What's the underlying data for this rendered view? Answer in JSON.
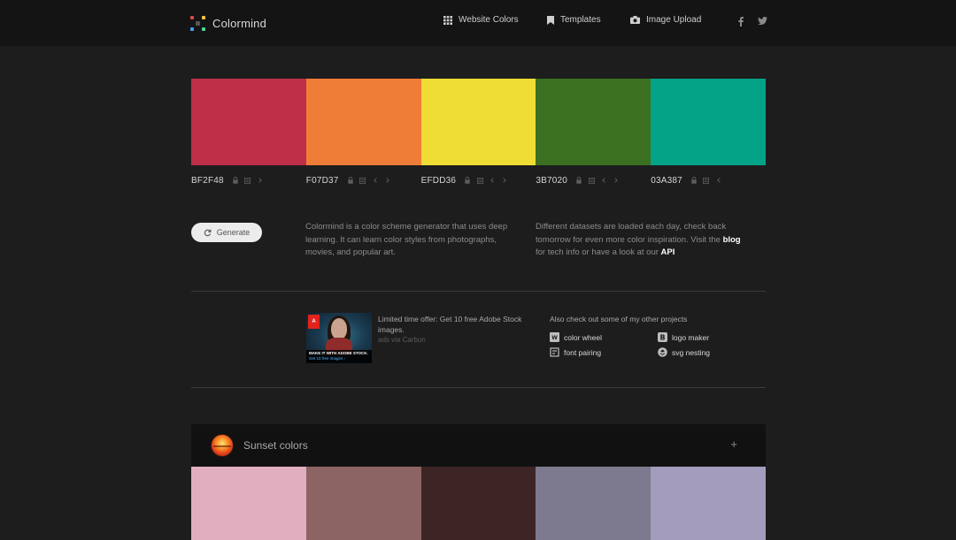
{
  "header": {
    "brand": "Colormind",
    "logo_colors": [
      "#e0474c",
      "#f3c340",
      "#43a3f0",
      "#4dd39a"
    ],
    "nav": [
      {
        "label": "Website Colors",
        "icon": "grid-icon"
      },
      {
        "label": "Templates",
        "icon": "bookmark-icon"
      },
      {
        "label": "Image Upload",
        "icon": "camera-icon"
      }
    ],
    "social": [
      {
        "icon": "facebook-icon"
      },
      {
        "icon": "twitter-icon"
      }
    ]
  },
  "palette": [
    {
      "hex": "#BF2F48",
      "code": "BF2F48"
    },
    {
      "hex": "#F07D37",
      "code": "F07D37"
    },
    {
      "hex": "#EFDD36",
      "code": "EFDD36"
    },
    {
      "hex": "#3B7020",
      "code": "3B7020"
    },
    {
      "hex": "#03A387",
      "code": "03A387"
    }
  ],
  "generate_label": "Generate",
  "intro": {
    "left": "Colormind is a color scheme generator that uses deep learning. It can learn color styles from photographs, movies, and popular art.",
    "right_before": "Different datasets are loaded each day, check back tomorrow for even more color inspiration. Visit the ",
    "right_link1": "blog",
    "right_middle": " for tech info or have a look at our ",
    "right_link2": "API"
  },
  "ad": {
    "badge": "Adobe",
    "caption_line1": "MAKE IT WITH ADOBE STOCK.",
    "caption_line2": "Get 10 free images ›",
    "text": "Limited time offer: Get 10 free Adobe Stock images.",
    "via": "ads via Carbon"
  },
  "other": {
    "title": "Also check out some of my other projects",
    "projects": [
      {
        "label": "color wheel",
        "icon": "color-wheel-icon"
      },
      {
        "label": "logo maker",
        "icon": "logo-maker-icon"
      },
      {
        "label": "font pairing",
        "icon": "font-pairing-icon"
      },
      {
        "label": "svg nesting",
        "icon": "svg-nesting-icon"
      }
    ]
  },
  "collection": {
    "title": "Sunset colors",
    "toggle": "+",
    "colors": [
      "#E1AEBF",
      "#8C6463",
      "#3D2526",
      "#7D7A8F",
      "#A39CBC"
    ]
  }
}
